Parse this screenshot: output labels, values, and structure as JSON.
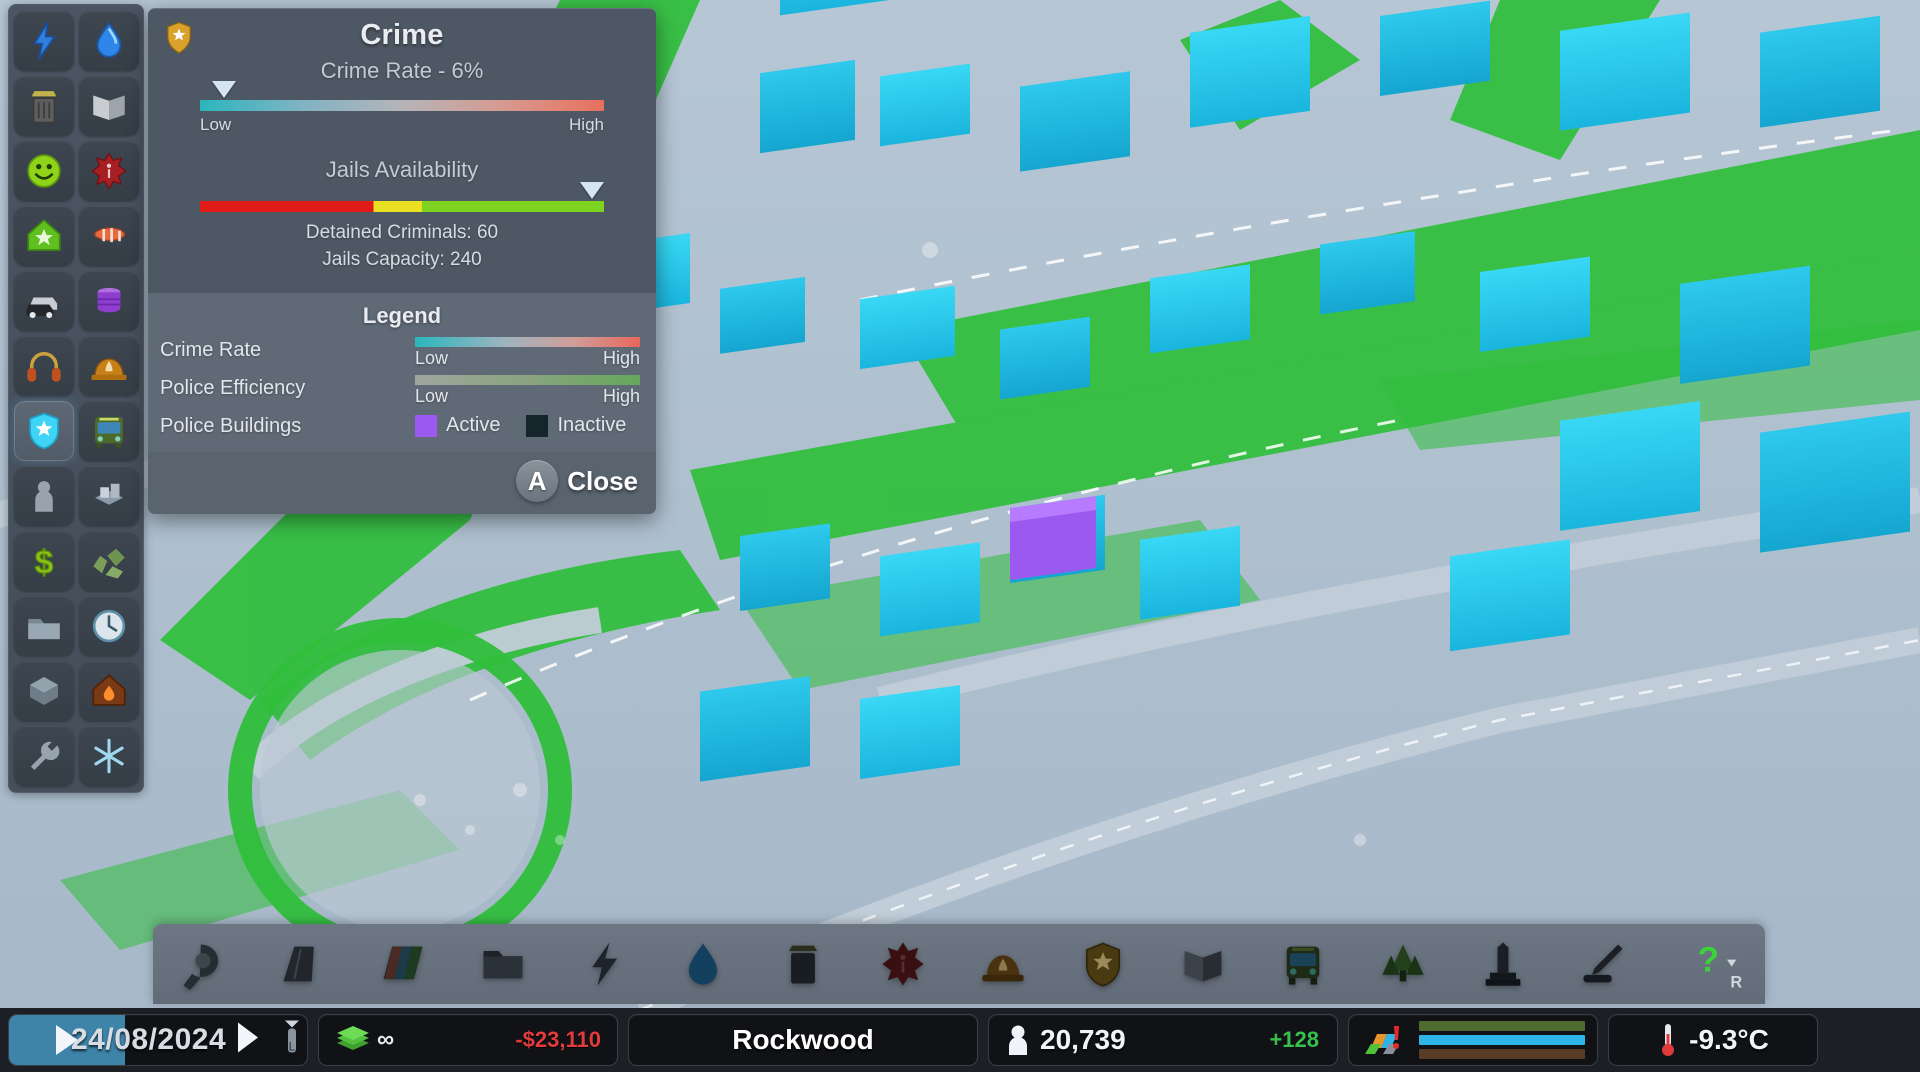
{
  "sidebar": {
    "items": [
      {
        "name": "electricity",
        "icon": "lightning-icon",
        "active": false
      },
      {
        "name": "water",
        "icon": "water-drop-icon",
        "active": false
      },
      {
        "name": "garbage",
        "icon": "trash-can-icon",
        "active": false
      },
      {
        "name": "education",
        "icon": "book-icon",
        "active": false
      },
      {
        "name": "happiness",
        "icon": "smiley-icon",
        "active": false
      },
      {
        "name": "healthcare",
        "icon": "medical-cross-icon",
        "active": false
      },
      {
        "name": "land-value",
        "icon": "house-star-icon",
        "active": false
      },
      {
        "name": "wind",
        "icon": "windsock-icon",
        "active": false
      },
      {
        "name": "traffic",
        "icon": "cars-icon",
        "active": false
      },
      {
        "name": "ground-pollution",
        "icon": "barrel-icon",
        "active": false
      },
      {
        "name": "noise-pollution",
        "icon": "headphones-icon",
        "active": false
      },
      {
        "name": "fire-safety",
        "icon": "fire-helmet-icon",
        "active": false
      },
      {
        "name": "crime",
        "icon": "police-badge-icon",
        "active": true
      },
      {
        "name": "public-transport",
        "icon": "bus-icon",
        "active": false
      },
      {
        "name": "population",
        "icon": "person-icon",
        "active": false
      },
      {
        "name": "districts",
        "icon": "blocks-icon",
        "active": false
      },
      {
        "name": "budget",
        "icon": "dollar-icon",
        "active": false
      },
      {
        "name": "natural-resources",
        "icon": "ore-icon",
        "active": false
      },
      {
        "name": "routes",
        "icon": "folder-icon",
        "active": false
      },
      {
        "name": "time",
        "icon": "clock-icon",
        "active": false
      },
      {
        "name": "terrain",
        "icon": "cube-icon",
        "active": false
      },
      {
        "name": "heating",
        "icon": "heating-house-icon",
        "active": false
      },
      {
        "name": "maintenance",
        "icon": "wrench-icon",
        "active": false
      },
      {
        "name": "snow",
        "icon": "snowflake-icon",
        "active": false
      }
    ]
  },
  "panel": {
    "badge_icon": "police-badge-icon",
    "title": "Crime",
    "crime_rate_label": "Crime Rate - 6%",
    "crime_marker_percent": 6,
    "crime_low_label": "Low",
    "crime_high_label": "High",
    "jails_title": "Jails Availability",
    "jails_marker_percent": 97,
    "detained_label": "Detained Criminals: 60",
    "capacity_label": "Jails Capacity: 240",
    "legend": {
      "title": "Legend",
      "rows": [
        {
          "label": "Crime Rate",
          "type": "gradient",
          "scale_low": "Low",
          "scale_high": "High"
        },
        {
          "label": "Police Efficiency",
          "type": "gradient",
          "scale_low": "Low",
          "scale_high": "High"
        },
        {
          "label": "Police Buildings",
          "type": "swatches",
          "active_label": "Active",
          "inactive_label": "Inactive",
          "active_color": "#9b59f0",
          "inactive_color": "#16242b"
        }
      ]
    },
    "close_key": "A",
    "close_label": "Close"
  },
  "toolbar": {
    "items": [
      {
        "name": "bulldozer",
        "icon": "bulldozer-icon"
      },
      {
        "name": "roads",
        "icon": "road-icon"
      },
      {
        "name": "zoning",
        "icon": "zoning-icon"
      },
      {
        "name": "districts",
        "icon": "district-folder-icon"
      },
      {
        "name": "electricity",
        "icon": "lightning-icon"
      },
      {
        "name": "water-sewage",
        "icon": "water-drop-icon"
      },
      {
        "name": "garbage",
        "icon": "trash-can-icon"
      },
      {
        "name": "healthcare",
        "icon": "medical-cross-icon"
      },
      {
        "name": "fire-department",
        "icon": "fire-helmet-icon"
      },
      {
        "name": "police",
        "icon": "police-badge-icon"
      },
      {
        "name": "education",
        "icon": "book-icon"
      },
      {
        "name": "public-transport",
        "icon": "bus-icon"
      },
      {
        "name": "parks-plazas",
        "icon": "tree-icon"
      },
      {
        "name": "unique-buildings",
        "icon": "monument-icon"
      },
      {
        "name": "landscaping",
        "icon": "landscape-tool-icon"
      }
    ],
    "help": {
      "name": "help",
      "label": "?",
      "sub": "R"
    }
  },
  "status": {
    "date": "24/08/2024",
    "play_icon": "play-icon",
    "fast_forward_icon": "fast-forward-icon",
    "speed_icon": "speed-toggle-icon",
    "money_icon": "money-stack-icon",
    "money_unlimited": "∞",
    "money_delta": "-$23,110",
    "city_name": "Rockwood",
    "population_icon": "person-icon",
    "population": "20,739",
    "population_delta": "+128",
    "infoview_icon": "infoview-icon",
    "mini_bars": [
      {
        "name": "green-bar",
        "color": "#4f6b30"
      },
      {
        "name": "blue-bar",
        "color": "#2fb4e8"
      },
      {
        "name": "brown-bar",
        "color": "#5a3c26"
      }
    ],
    "temperature_icon": "thermometer-icon",
    "temperature": "-9.3°C"
  }
}
